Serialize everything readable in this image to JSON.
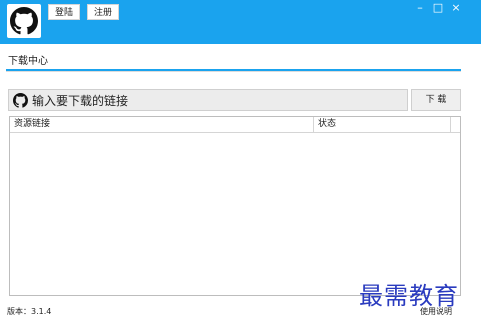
{
  "header": {
    "login_label": "登陆",
    "register_label": "注册",
    "window_controls": {
      "minimize": "–",
      "maximize": "□",
      "close": "×"
    }
  },
  "tabs": [
    {
      "label": "下载中心",
      "active": true
    }
  ],
  "download": {
    "input_placeholder": "输入要下载的链接",
    "button_label": "下 载",
    "icon": "github-icon"
  },
  "table": {
    "columns": [
      "资源链接",
      "状态"
    ],
    "rows": []
  },
  "footer": {
    "version": "版本：3.1.4",
    "help": "使用说明"
  },
  "watermark": "最需教育",
  "colors": {
    "accent": "#1aa3ee",
    "watermark": "#2a3bbf"
  }
}
